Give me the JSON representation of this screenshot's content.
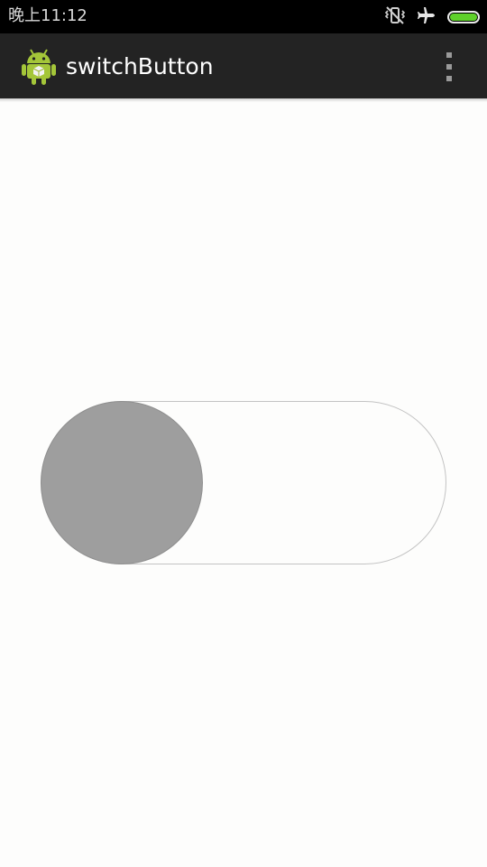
{
  "status_bar": {
    "time": "晚上11:12",
    "icons": [
      "vibrate-off-icon",
      "airplane-mode-icon",
      "battery-icon"
    ],
    "battery_color": "#5fd12b",
    "battery_level": 1.0
  },
  "action_bar": {
    "title": "switchButton",
    "app_icon": "android-robot-icon",
    "menu_icon": "overflow-menu-icon",
    "background_color": "#232323"
  },
  "switch": {
    "checked": false,
    "track_color": "#fdfdfc",
    "thumb_color": "#9e9e9e"
  }
}
